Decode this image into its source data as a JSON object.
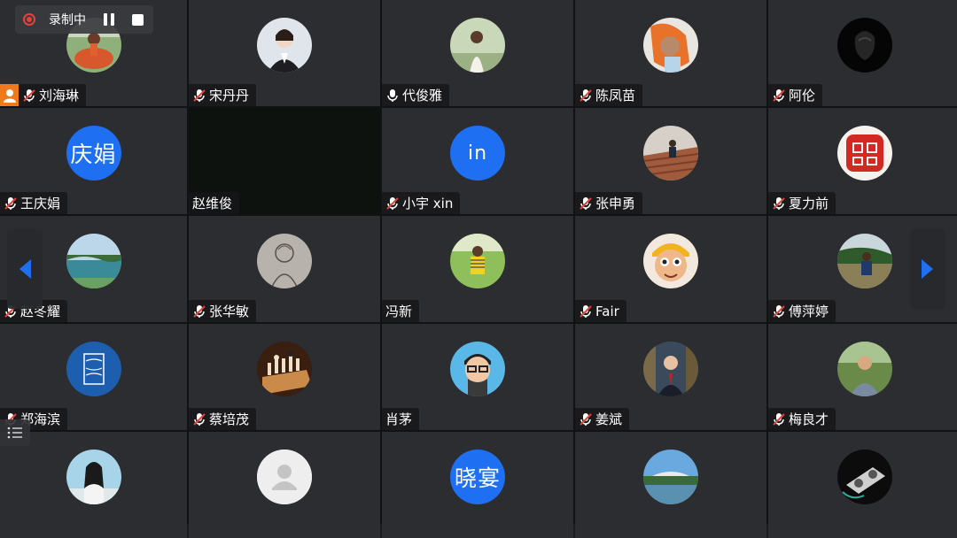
{
  "recording": {
    "label": "录制中"
  },
  "participants": [
    {
      "name": "刘海琳",
      "mic": "muted",
      "host": true
    },
    {
      "name": "宋丹丹",
      "mic": "muted"
    },
    {
      "name": "代俊雅",
      "mic": "on"
    },
    {
      "name": "陈凤苗",
      "mic": "muted"
    },
    {
      "name": "阿伦",
      "mic": "muted"
    },
    {
      "name": "王庆娟",
      "mic": "muted",
      "avatar_text": "庆娟"
    },
    {
      "name": "赵维俊",
      "mic": "none",
      "video": true
    },
    {
      "name": "小宇 xin",
      "mic": "muted",
      "avatar_text": "in"
    },
    {
      "name": "张申勇",
      "mic": "muted"
    },
    {
      "name": "夏力前",
      "mic": "muted"
    },
    {
      "name": "赵冬耀",
      "mic": "muted"
    },
    {
      "name": "张华敏",
      "mic": "muted"
    },
    {
      "name": "冯新",
      "mic": "none"
    },
    {
      "name": "Fair",
      "mic": "muted"
    },
    {
      "name": "傅萍婷",
      "mic": "muted"
    },
    {
      "name": "郑海滨",
      "mic": "muted"
    },
    {
      "name": "蔡培茂",
      "mic": "muted"
    },
    {
      "name": "肖茅",
      "mic": "none"
    },
    {
      "name": "姜斌",
      "mic": "muted"
    },
    {
      "name": "梅良才",
      "mic": "muted"
    },
    {
      "name": "",
      "mic": "none"
    },
    {
      "name": "",
      "mic": "none"
    },
    {
      "name": "",
      "mic": "none",
      "avatar_text": "晓宴"
    },
    {
      "name": "",
      "mic": "none"
    },
    {
      "name": "",
      "mic": "none"
    }
  ],
  "colors": {
    "accent": "#1e6ff2",
    "record": "#e5423c",
    "host": "#f07a1b",
    "tile": "#2c2d30"
  }
}
